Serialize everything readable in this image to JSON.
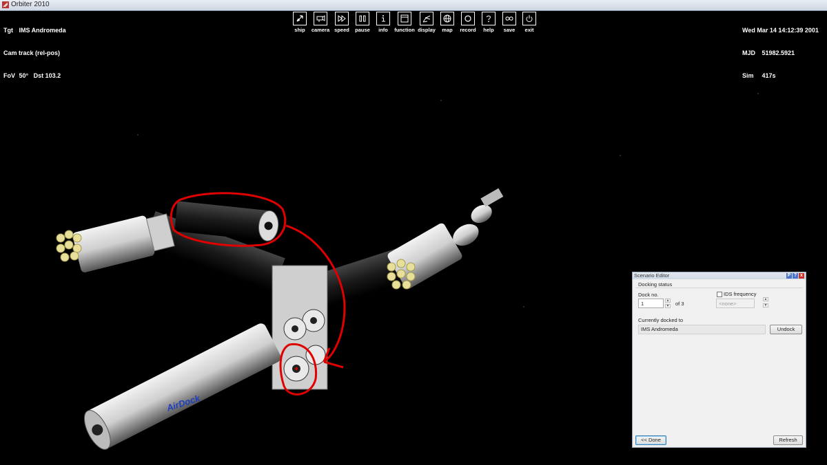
{
  "window": {
    "title": "Orbiter 2010"
  },
  "hud_left": {
    "rows": [
      {
        "key": "Tgt",
        "value": "IMS Andromeda"
      },
      {
        "key": "",
        "value": "Cam track (rel-pos)"
      },
      {
        "key": "FoV",
        "value": "50°   Dst 103.2"
      }
    ]
  },
  "hud_right": {
    "rows": [
      {
        "key": "",
        "value": "Wed Mar 14 14:12:39 2001"
      },
      {
        "key": "MJD",
        "value": "51982.5921"
      },
      {
        "key": "Sim",
        "value": "417s"
      }
    ]
  },
  "toolbar": {
    "buttons": [
      {
        "label": "ship",
        "icon": "rocket-icon"
      },
      {
        "label": "camera",
        "icon": "camera-icon"
      },
      {
        "label": "speed",
        "icon": "fast-forward-icon"
      },
      {
        "label": "pause",
        "icon": "pause-icon"
      },
      {
        "label": "info",
        "icon": "info-icon"
      },
      {
        "label": "function",
        "icon": "window-icon"
      },
      {
        "label": "display",
        "icon": "display-icon"
      },
      {
        "label": "map",
        "icon": "globe-icon"
      },
      {
        "label": "record",
        "icon": "record-icon"
      },
      {
        "label": "help",
        "icon": "help-icon"
      },
      {
        "label": "save",
        "icon": "save-icon"
      },
      {
        "label": "exit",
        "icon": "power-icon"
      }
    ]
  },
  "scenario_editor": {
    "title": "Scenario Editor",
    "title_buttons": [
      "P",
      "?",
      "x"
    ],
    "group_label": "Docking status",
    "dock_no_label": "Dock no.",
    "dock_no_value": "1",
    "of_label": "of 3",
    "ids_label": "IDS frequency",
    "ids_value": "<none>",
    "docked_label": "Currently docked to",
    "docked_value": "IMS Andromeda",
    "undock_label": "Undock",
    "done_label": "<< Done",
    "refresh_label": "Refresh"
  },
  "colors": {
    "background": "#000000",
    "annotation": "#e00000",
    "hud_text": "#ffffff"
  }
}
